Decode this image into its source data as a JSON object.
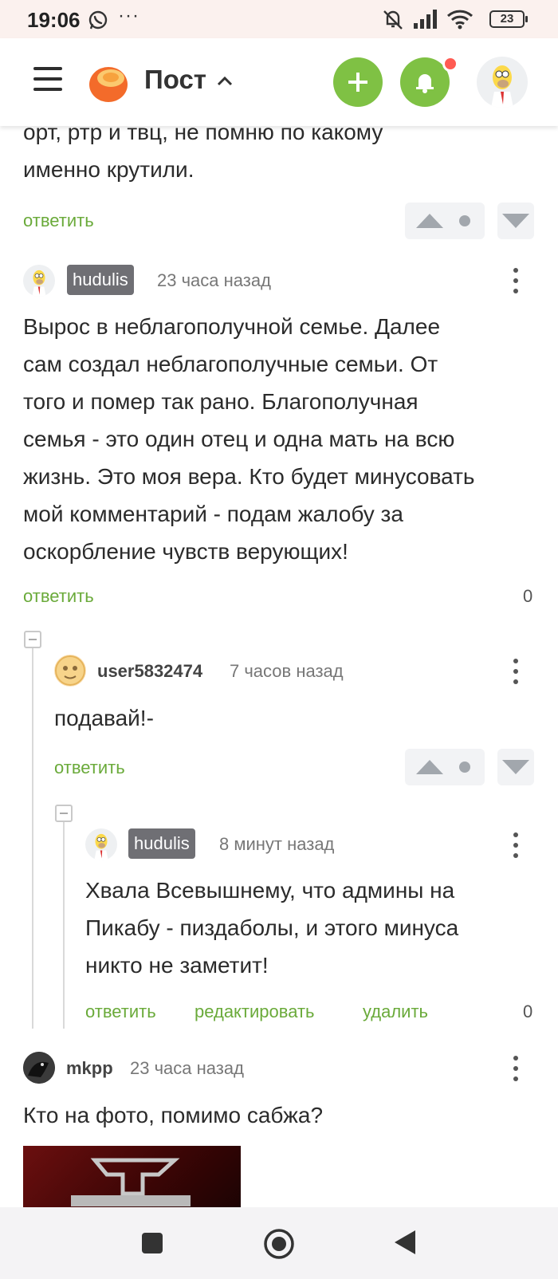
{
  "status_bar": {
    "time": "19:06",
    "dots": "···",
    "battery": "23"
  },
  "header": {
    "title": "Пост"
  },
  "top_comment": {
    "text_lines": [
      "орт, ртр и твц, не помню по какому",
      "именно крутили."
    ],
    "reply": "ответить"
  },
  "comments": [
    {
      "author": "hudulis",
      "time": "23 часа назад",
      "text_lines": [
        "Вырос в неблагополучной семье. Далее",
        "сам создал неблагополучные семьи. От",
        "того и помер так рано. Благополучная",
        "семья - это один отец и одна мать на всю",
        "жизнь. Это моя вера. Кто будет минусовать",
        "мой комментарий - подам жалобу за",
        "оскорбление чувств верующих!"
      ],
      "reply": "ответить",
      "rating": "0"
    },
    {
      "author": "user5832474",
      "time": "7 часов назад",
      "text": "подавай!-",
      "reply": "ответить"
    },
    {
      "author": "hudulis",
      "time": "8 минут назад",
      "text_lines": [
        "Хвала Всевышнему, что админы на",
        "Пикабу - пиздаболы, и этого минуса",
        "никто не заметит!"
      ],
      "reply": "ответить",
      "edit": "редактировать",
      "delete": "удалить",
      "rating": "0"
    },
    {
      "author": "mkpp",
      "time": "23 часа назад",
      "text": "Кто на фото, помимо сабжа?"
    }
  ],
  "colors": {
    "accent_green": "#7fc144",
    "link_green": "#6aaa3a",
    "badge_gray": "#6f6f74",
    "notification_red": "#ff5b52"
  }
}
